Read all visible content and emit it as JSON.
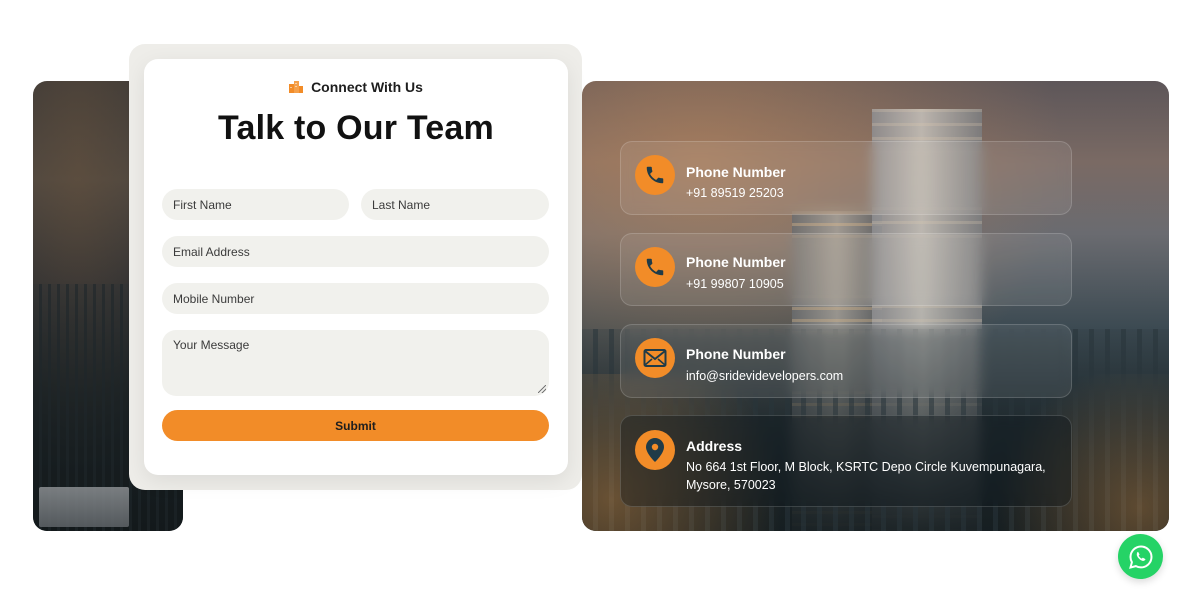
{
  "form": {
    "eyebrow": "Connect With Us",
    "title": "Talk to Our Team",
    "first_name_placeholder": "First Name",
    "last_name_placeholder": "Last Name",
    "email_placeholder": "Email Address",
    "mobile_placeholder": "Mobile Number",
    "message_placeholder": "Your Message",
    "submit_label": "Submit"
  },
  "contacts": [
    {
      "icon": "phone-icon",
      "title": "Phone Number",
      "value": "+91 89519 25203"
    },
    {
      "icon": "phone-icon",
      "title": "Phone Number",
      "value": "+91 99807 10905"
    },
    {
      "icon": "mail-icon",
      "title": "Phone Number",
      "value": "info@sridevidevelopers.com"
    },
    {
      "icon": "location-pin-icon",
      "title": "Address",
      "value": "No 664 1st Floor, M Block, KSRTC Depo Circle Kuvempunagara, Mysore, 570023"
    }
  ],
  "floating": {
    "icon": "whatsapp-icon"
  },
  "colors": {
    "accent": "#f28c28",
    "whatsapp": "#25d366",
    "field_bg": "#f1f1ed"
  }
}
